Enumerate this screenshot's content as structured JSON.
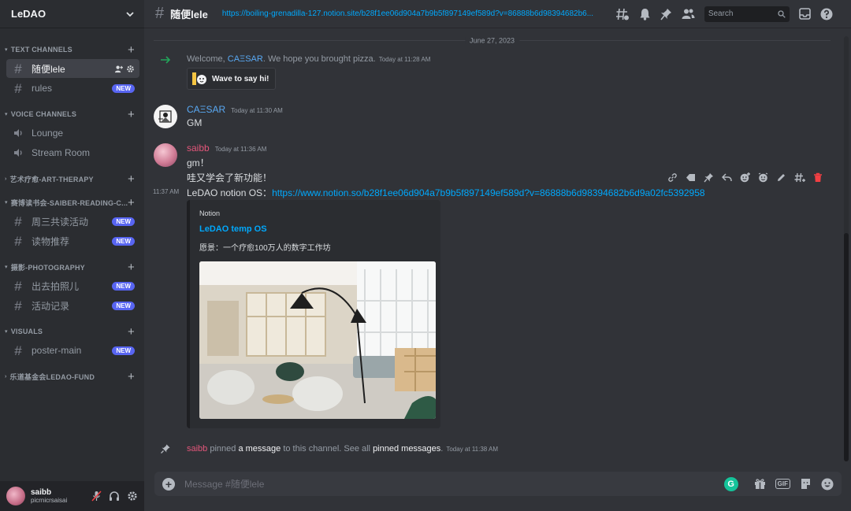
{
  "server": {
    "name": "LeDAO"
  },
  "sidebar": {
    "categories": [
      {
        "label": "TEXT CHANNELS"
      },
      {
        "label": "VOICE CHANNELS"
      },
      {
        "label": "艺术疗愈-ART-THERAPY"
      },
      {
        "label": "赛博读书会-SAIBER-READING-C..."
      },
      {
        "label": "摄影-PHOTOGRAPHY"
      },
      {
        "label": "VISUALS"
      },
      {
        "label": "乐道基金会LEDAO-FUND"
      }
    ],
    "channels": {
      "suibian": "随便lele",
      "rules": "rules",
      "lounge": "Lounge",
      "stream": "Stream Room",
      "zhousan": "周三共读活动",
      "duwu": "读物推荐",
      "chuqu": "出去拍照儿",
      "huodong": "活动记录",
      "poster": "poster-main"
    },
    "new_badge": "NEW"
  },
  "user": {
    "name": "saibb",
    "tag": "picrnicrsaisai"
  },
  "topbar": {
    "channel": "随便lele",
    "url": "https://boiling-grenadilla-127.notion.site/b28f1ee06d904a7b9b5f897149ef589d?v=86888b6d98394682b6...",
    "search_placeholder": "Search"
  },
  "chat": {
    "date_divider": "June 27, 2023",
    "welcome": {
      "prefix": "Welcome, ",
      "name": "CAΞSAR",
      "suffix": ". We hope you brought pizza.",
      "timestamp": "Today at 11:28 AM",
      "wave_label": "Wave to say hi!"
    },
    "msg1": {
      "author": "CAΞSAR",
      "timestamp": "Today at 11:30 AM",
      "text": "GM"
    },
    "msg2": {
      "author": "saibb",
      "timestamp": "Today at 11:36 AM",
      "line1": "gm！",
      "line2": "哇又学会了新功能！",
      "hover_time": "11:37 AM",
      "line3_prefix": "LeDAO notion OS：",
      "line3_link": "https://www.notion.so/b28f1ee06d904a7b9b5f897149ef589d?v=86888b6d98394682b6d9a02fc5392958",
      "embed": {
        "provider": "Notion",
        "title": "LeDAO temp OS",
        "description": "愿景：一个疗愈100万人的数字工作坊"
      }
    },
    "pin": {
      "author": "saibb",
      "text1": " pinned ",
      "bold1": "a message",
      "text2": " to this channel. See all ",
      "bold2": "pinned messages",
      "text3": ".",
      "timestamp": "Today at 11:38 AM"
    },
    "input_placeholder": "Message #随便lele"
  }
}
